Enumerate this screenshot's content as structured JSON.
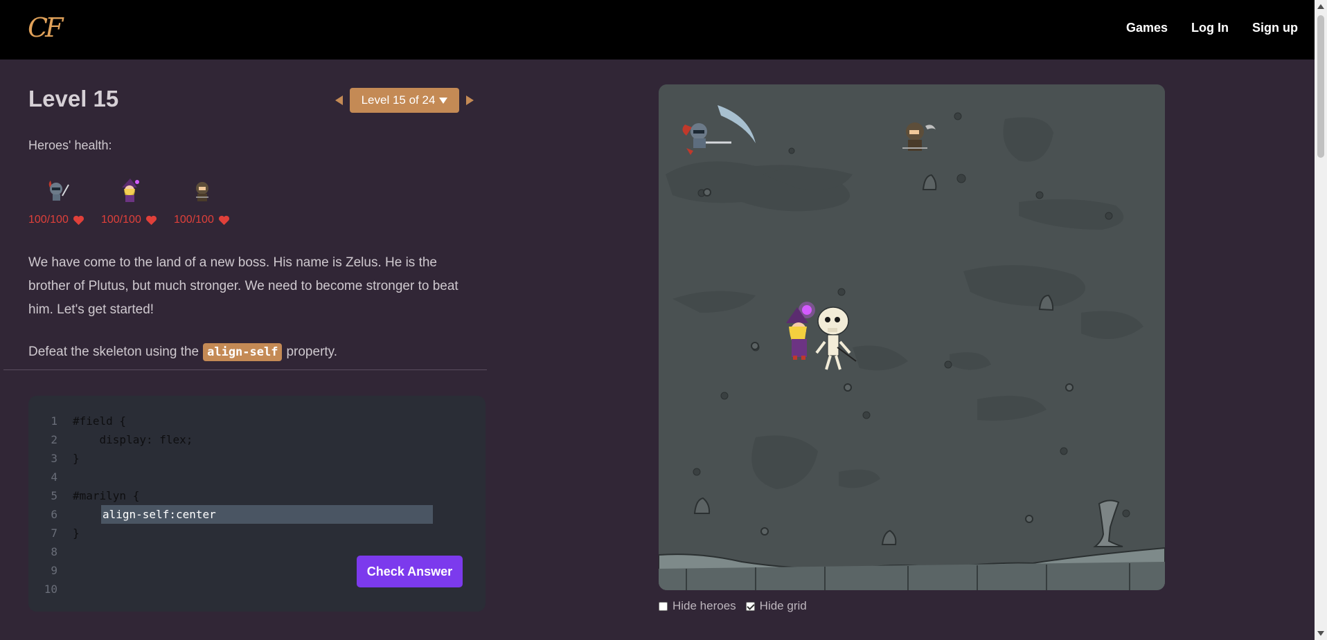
{
  "app": {
    "logo_text": "CF",
    "nav": {
      "games": "Games",
      "login": "Log In",
      "signup": "Sign up"
    }
  },
  "level": {
    "title": "Level 15",
    "selector_label": "Level 15 of 24"
  },
  "health": {
    "label": "Heroes' health:",
    "heroes": [
      {
        "icon": "knight-hero-icon",
        "hp": "100/100"
      },
      {
        "icon": "wizard-hero-icon",
        "hp": "100/100"
      },
      {
        "icon": "rogue-hero-icon",
        "hp": "100/100"
      }
    ]
  },
  "story": "We have come to the land of a new boss. His name is Zelus. He is the brother of Plutus, but much stronger. We need to become stronger to beat him. Let's get started!",
  "task": {
    "before": "Defeat the skeleton using the",
    "property": "align-self",
    "after": "property."
  },
  "editor": {
    "lines": [
      {
        "n": "1",
        "code": "#field {"
      },
      {
        "n": "2",
        "code": "    display: flex;"
      },
      {
        "n": "3",
        "code": "}"
      },
      {
        "n": "4",
        "code": ""
      },
      {
        "n": "5",
        "code": "#marilyn {"
      },
      {
        "n": "6",
        "code": ""
      },
      {
        "n": "7",
        "code": "}"
      },
      {
        "n": "8",
        "code": ""
      },
      {
        "n": "9",
        "code": ""
      },
      {
        "n": "10",
        "code": ""
      }
    ],
    "answer_value": "align-self:center",
    "check_label": "Check Answer"
  },
  "field_options": {
    "hide_heroes": "Hide heroes",
    "hide_heroes_checked": false,
    "hide_grid": "Hide grid",
    "hide_grid_checked": true
  },
  "colors": {
    "accent": "#c48a55",
    "button": "#7c3aed",
    "health": "#e0403a",
    "background": "#312636"
  }
}
